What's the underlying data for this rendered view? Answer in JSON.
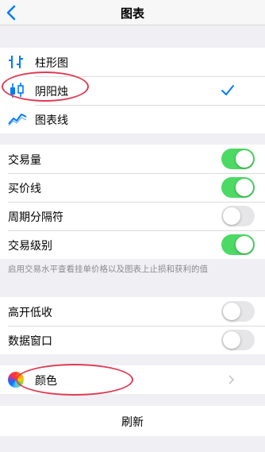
{
  "nav": {
    "title": "图表"
  },
  "chart_types": [
    {
      "label": "柱形图",
      "icon": "bar-chart-icon",
      "selected": false
    },
    {
      "label": "阴阳烛",
      "icon": "candlestick-icon",
      "selected": true
    },
    {
      "label": "图表线",
      "icon": "line-chart-icon",
      "selected": false
    }
  ],
  "options": [
    {
      "label": "交易量",
      "on": true
    },
    {
      "label": "买价线",
      "on": true
    },
    {
      "label": "周期分隔符",
      "on": false
    },
    {
      "label": "交易级别",
      "on": true
    }
  ],
  "options_note": "启用交易水平查看挂单价格以及图表上止损和获利的值",
  "extra_options": [
    {
      "label": "高开低收",
      "on": false
    },
    {
      "label": "数据窗口",
      "on": false
    }
  ],
  "color": {
    "label": "颜色",
    "icon": "color-wheel-icon"
  },
  "refresh": {
    "label": "刷新"
  },
  "colors": {
    "accent": "#007aff",
    "toggle_on": "#4cd964",
    "highlight": "#e23a53"
  }
}
